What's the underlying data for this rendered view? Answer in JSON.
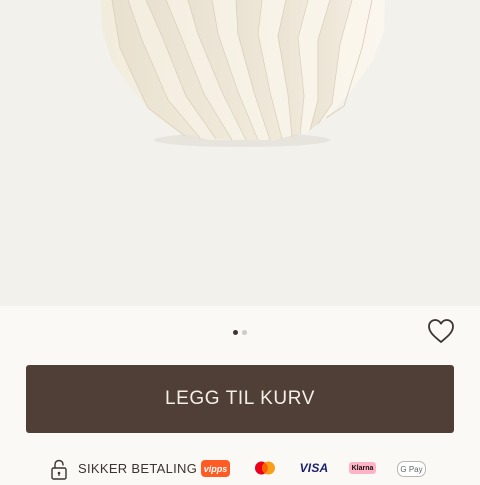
{
  "product": {
    "image_subject": "folded-paper-vase"
  },
  "carousel": {
    "slide_count": 2,
    "active_slide": 1
  },
  "actions": {
    "add_to_cart_label": "LEGG TIL KURV",
    "favorite_icon": "heart-outline-icon"
  },
  "payment": {
    "secure_label": "SIKKER BETALING",
    "secure_icon": "lock-icon",
    "methods": {
      "vipps": "vipps",
      "mastercard": "mastercard",
      "visa": "VISA",
      "klarna": "Klarna",
      "gpay": "G Pay"
    }
  },
  "colors": {
    "button": "#4f3f36",
    "background": "#faf9f6",
    "vipps": "#ff5b24",
    "klarna": "#ffb3c7",
    "visa": "#1a1f71"
  }
}
